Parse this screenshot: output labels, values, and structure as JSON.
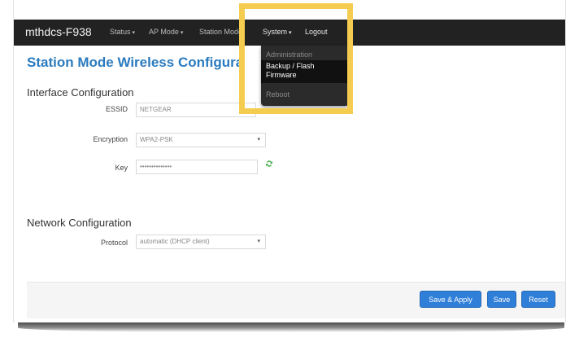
{
  "navbar": {
    "brand": "mthdcs-F938",
    "items": [
      {
        "label": "Status",
        "has_caret": true
      },
      {
        "label": "AP Mode",
        "has_caret": true
      },
      {
        "label": "Station Mode",
        "has_caret": false
      },
      {
        "label": "System",
        "has_caret": true
      },
      {
        "label": "Logout",
        "has_caret": false
      }
    ],
    "caret_glyph": "▾"
  },
  "system_menu": {
    "items": [
      "Administration",
      "Backup / Flash",
      "Firmware",
      "Reboot"
    ]
  },
  "page": {
    "title": "Station Mode Wireless Configura"
  },
  "interface": {
    "title": "Interface Configuration",
    "essid_label": "ESSID",
    "essid_value": "NETGEAR",
    "encryption_label": "Encryption",
    "encryption_value": "WPA2-PSK",
    "key_label": "Key",
    "key_value": "••••••••••••••"
  },
  "network": {
    "title": "Network Configuration",
    "protocol_label": "Protocol",
    "protocol_value": "automatic (DHCP client)"
  },
  "buttons": {
    "save_apply": "Save & Apply",
    "save": "Save",
    "reset": "Reset"
  },
  "colors": {
    "accent": "#2b7bbf",
    "button": "#2f7ed8",
    "navbar": "#222222",
    "highlight": "#f4cd50",
    "icon_green": "#4caf50"
  }
}
